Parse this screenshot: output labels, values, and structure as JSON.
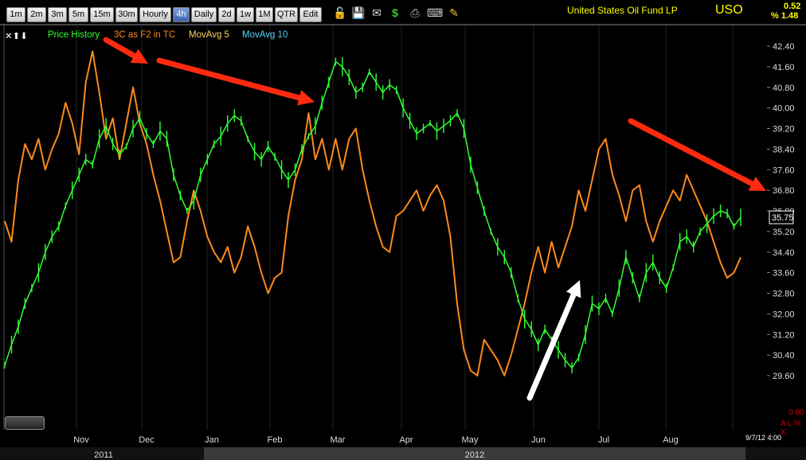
{
  "toolbar": {
    "timeframes": [
      "1m",
      "2m",
      "3m",
      "5m",
      "15m",
      "30m",
      "Hourly",
      "4h",
      "Daily",
      "2d",
      "1w",
      "1M",
      "QTR",
      "Edit"
    ],
    "active_timeframe": "4h",
    "icons": [
      "lock-icon",
      "save-icon",
      "email-icon",
      "dollar-icon",
      "print-icon",
      "keyboard-icon",
      "pencil-icon"
    ]
  },
  "header": {
    "symbol_name": "United States Oil Fund LP",
    "ticker": "USO",
    "change": "0.52",
    "change_pct": "% 1.48"
  },
  "legend": {
    "controls": "✕⬆⬇",
    "items": [
      "Price History",
      "3C as F2 in TC",
      "MovAvg 5",
      "MovAvg 10"
    ],
    "colors": [
      "#33ff33",
      "#ff8a1c",
      "#ffd35a",
      "#55d4ff"
    ]
  },
  "price_scale": {
    "labels": [
      "42.40",
      "41.60",
      "40.80",
      "40.00",
      "39.20",
      "38.40",
      "37.60",
      "36.80",
      "36.00",
      "35.20",
      "34.40",
      "33.60",
      "32.80",
      "32.00",
      "31.20",
      "30.40",
      "29.60"
    ],
    "current_price": "35.75"
  },
  "indicator": {
    "value": "0.80",
    "controls": "A L % X"
  },
  "time_axis": {
    "months": [
      "Nov",
      "Dec",
      "Jan",
      "Feb",
      "Mar",
      "Apr",
      "May",
      "Jun",
      "Jul",
      "Aug"
    ],
    "years": [
      "2011",
      "2012"
    ]
  },
  "footer": {
    "date_stamp": "9/7/12 4:00"
  },
  "colors": {
    "price": "#33ff33",
    "indicator": "#ff8a1c",
    "arrow_red": "#ff2a10",
    "arrow_white": "#ffffff",
    "ticker": "#ffff00"
  },
  "chart_data": {
    "type": "line",
    "series": [
      {
        "name": "Price History",
        "values": [
          30.0,
          30.8,
          31.5,
          32.4,
          33.0,
          33.6,
          34.4,
          35.0,
          35.4,
          36.2,
          36.8,
          37.4,
          38.0,
          37.8,
          38.8,
          39.3,
          38.6,
          38.2,
          38.5,
          39.2,
          39.6,
          39.0,
          38.6,
          39.1,
          38.8,
          37.4,
          36.6,
          36.0,
          36.4,
          37.4,
          38.0,
          38.6,
          38.9,
          39.4,
          39.7,
          39.5,
          38.8,
          38.3,
          38.0,
          38.5,
          38.1,
          37.6,
          37.2,
          37.6,
          38.4,
          38.9,
          39.3,
          40.2,
          41.0,
          41.8,
          41.6,
          41.2,
          40.6,
          40.8,
          41.4,
          41.0,
          40.6,
          40.9,
          40.7,
          40.0,
          39.5,
          39.0,
          39.2,
          39.4,
          39.1,
          39.3,
          39.5,
          39.8,
          39.2,
          37.8,
          36.9,
          36.0,
          35.2,
          34.6,
          34.2,
          33.6,
          32.6,
          31.8,
          31.4,
          30.8,
          31.4,
          31.0,
          30.6,
          30.2,
          29.9,
          30.3,
          31.2,
          32.4,
          32.2,
          32.6,
          32.0,
          33.0,
          34.2,
          33.4,
          32.6,
          33.6,
          34.0,
          33.4,
          33.0,
          33.8,
          34.8,
          35.0,
          34.6,
          35.2,
          35.5,
          35.8,
          36.0,
          35.9,
          35.4,
          35.75
        ]
      },
      {
        "name": "3C as F2 in TC",
        "values": [
          35.6,
          34.8,
          37.2,
          38.6,
          38.0,
          38.8,
          37.6,
          38.4,
          39.0,
          40.2,
          39.4,
          38.2,
          41.0,
          42.2,
          40.6,
          38.8,
          39.6,
          38.0,
          39.4,
          40.8,
          39.4,
          38.6,
          37.4,
          36.4,
          35.2,
          34.0,
          34.2,
          35.6,
          36.8,
          36.0,
          35.0,
          34.4,
          34.0,
          34.6,
          33.6,
          34.2,
          35.4,
          34.6,
          33.6,
          32.8,
          33.4,
          33.6,
          35.8,
          37.2,
          38.0,
          39.8,
          38.0,
          38.8,
          37.6,
          38.8,
          37.6,
          38.8,
          39.2,
          37.6,
          36.4,
          35.4,
          34.6,
          34.4,
          35.8,
          36.0,
          36.4,
          36.8,
          36.0,
          36.6,
          37.0,
          36.4,
          35.0,
          32.4,
          30.6,
          29.8,
          29.6,
          31.0,
          30.6,
          30.2,
          29.6,
          30.4,
          31.4,
          32.4,
          33.6,
          34.6,
          33.6,
          34.8,
          33.8,
          34.6,
          35.4,
          36.8,
          36.0,
          37.2,
          38.4,
          38.8,
          37.4,
          36.6,
          35.6,
          36.8,
          37.0,
          35.6,
          34.8,
          35.6,
          36.2,
          36.8,
          36.4,
          37.4,
          36.8,
          36.2,
          35.6,
          34.8,
          34.0,
          33.4,
          33.6,
          34.2
        ]
      }
    ],
    "ylim": [
      29.6,
      42.4
    ],
    "x_categories": [
      "Nov",
      "Dec",
      "Jan",
      "Feb",
      "Mar",
      "Apr",
      "May",
      "Jun",
      "Jul",
      "Aug"
    ]
  }
}
